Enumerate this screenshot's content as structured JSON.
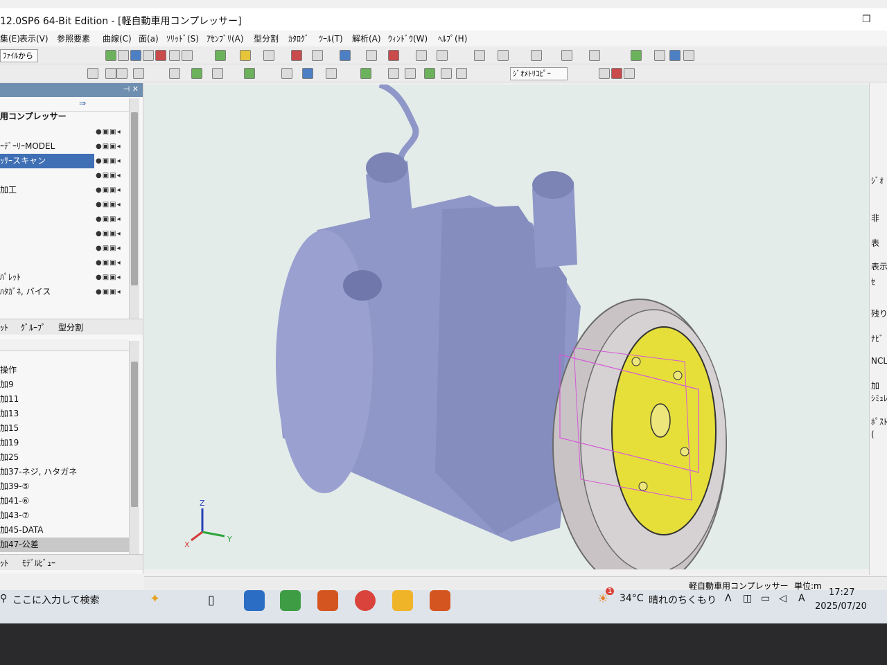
{
  "window": {
    "title": "12.0SP6  64-Bit Edition - [軽自動車用コンプレッサー]"
  },
  "menu": [
    "集(E)",
    "表示(V)",
    "参照要素",
    "曲線(C)",
    "面(a)",
    "ｿﾘｯﾄﾞ(S)",
    "ｱｾﾝﾌﾞﾘ(A)",
    "型分割",
    "ｶﾀﾛｸﾞ",
    "ﾂｰﾙ(T)",
    "解析(A)",
    "ｳｨﾝﾄﾞｳ(W)",
    "ﾍﾙﾌﾟ(H)"
  ],
  "toolbar": {
    "file_combo": "ﾌｧｲﾙから",
    "geometry_copy": "ｼﾞｵﾒﾄﾘｺﾋﾟｰ"
  },
  "tree": {
    "root": "用コンプレッサー",
    "rows": [
      "",
      "ｰﾃﾞｰﾘｰMODEL",
      "ｯｻｰスキャン",
      "",
      "加工",
      "",
      "",
      "",
      "",
      "",
      "ﾊﾟﾚｯﾄ",
      "ﾊﾀｶﾞﾈ, バイス"
    ],
    "selected_index": 2,
    "tabs": [
      "ｯﾄ",
      "ｸﾞﾙｰﾌﾟ",
      "型分割"
    ]
  },
  "ops": {
    "rows": [
      "操作",
      "加9",
      "加11",
      "加13",
      "加15",
      "加19",
      "加25",
      "加37-ネジ, ハタガネ",
      "加39-⑤",
      "加41-⑥",
      "加43-⑦",
      "加45-DATA",
      "加47-公差"
    ],
    "selected_index": 12,
    "tabs": [
      "ｯﾄ",
      "ﾓﾃﾞﾙﾋﾞｭｰ"
    ]
  },
  "axes": {
    "z": "Z",
    "y": "Y",
    "x": "X"
  },
  "right_panel": [
    "ｼﾞｵ",
    "非",
    "表",
    "表示/",
    "ｾ",
    "残り",
    "ﾅﾋﾞ",
    "NCL",
    "加",
    "ｼﾐｭﾚ",
    "ﾎﾟｽﾄ",
    "("
  ],
  "status": {
    "model": "軽自動車用コンプレッサー",
    "unit": "単位:m"
  },
  "taskbar": {
    "search_placeholder": "ここに入力して検索",
    "weather_temp": "34°C",
    "weather_text": "晴れのちくもり",
    "time": "17:27",
    "date": "2025/07/20",
    "ime": "A",
    "notif_count": "1"
  },
  "colors": {
    "viewport_bg": "#e3ece9",
    "part_body": "#8f97c8",
    "pulley": "#c9c3c6",
    "plate": "#e6df3a",
    "selection": "#3f6fb4"
  }
}
